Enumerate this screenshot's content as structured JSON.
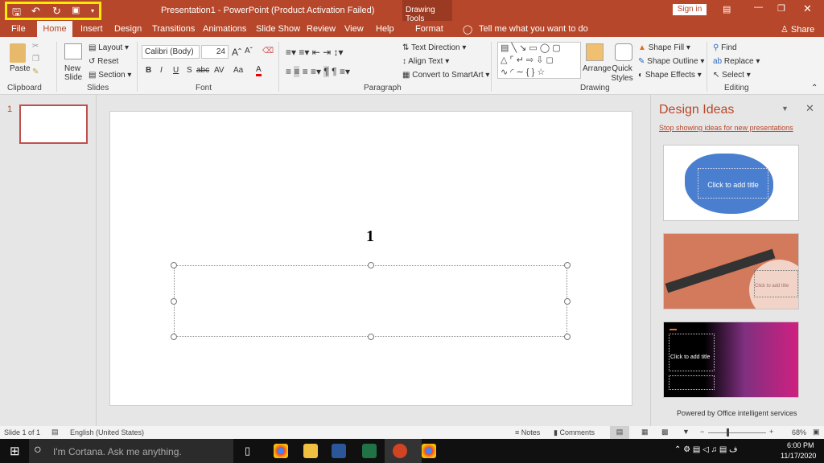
{
  "window": {
    "title": "Presentation1  -  PowerPoint (Product Activation Failed)",
    "context_tab_group": "Drawing Tools",
    "sign_in": "Sign in"
  },
  "qat": {
    "items": [
      "save-icon",
      "undo-icon",
      "redo-icon",
      "present-icon",
      "customize-icon"
    ],
    "highlight_color": "#ffeb00"
  },
  "tabs": [
    "File",
    "Home",
    "Insert",
    "Design",
    "Transitions",
    "Animations",
    "Slide Show",
    "Review",
    "View",
    "Help",
    "Format"
  ],
  "tell_me": "Tell me what you want to do",
  "share": "Share",
  "ribbon": {
    "clipboard": {
      "label": "Clipboard",
      "paste": "Paste"
    },
    "slides": {
      "label": "Slides",
      "new_slide": "New Slide",
      "layout": "Layout",
      "reset": "Reset",
      "section": "Section"
    },
    "font": {
      "label": "Font",
      "font_name": "Calibri (Body)",
      "font_size": "24",
      "bold": "B",
      "italic": "I",
      "underline": "U",
      "strike": "S",
      "abc": "abc",
      "spacing": "AV",
      "case": "Aa",
      "color": "A"
    },
    "paragraph": {
      "label": "Paragraph",
      "text_direction": "Text Direction",
      "align_text": "Align Text",
      "convert": "Convert to SmartArt"
    },
    "drawing": {
      "label": "Drawing",
      "arrange": "Arrange",
      "quick_styles": "Quick Styles",
      "shape_fill": "Shape Fill",
      "shape_outline": "Shape Outline",
      "shape_effects": "Shape Effects"
    },
    "editing": {
      "label": "Editing",
      "find": "Find",
      "replace": "Replace",
      "select": "Select"
    }
  },
  "thumbnails": [
    {
      "number": "1"
    }
  ],
  "slide": {
    "cursor_label": "1"
  },
  "design_ideas": {
    "title": "Design Ideas",
    "stop_link": "Stop showing ideas for new presentations",
    "ideas": [
      "Click to add title",
      "Click to add title",
      "Click to add title"
    ],
    "footer": "Powered by Office intelligent services"
  },
  "status": {
    "slide": "Slide 1 of 1",
    "language": "English (United States)",
    "notes": "Notes",
    "comments": "Comments",
    "zoom": "68%",
    "zoom_level": 68
  },
  "taskbar": {
    "cortana": "I'm Cortana. Ask me anything.",
    "time": "6:00 PM",
    "date": "11/17/2020",
    "apps": [
      "chrome",
      "file-explorer",
      "word",
      "excel",
      "powerpoint",
      "chrome"
    ]
  },
  "colors": {
    "accent": "#b7472a"
  }
}
